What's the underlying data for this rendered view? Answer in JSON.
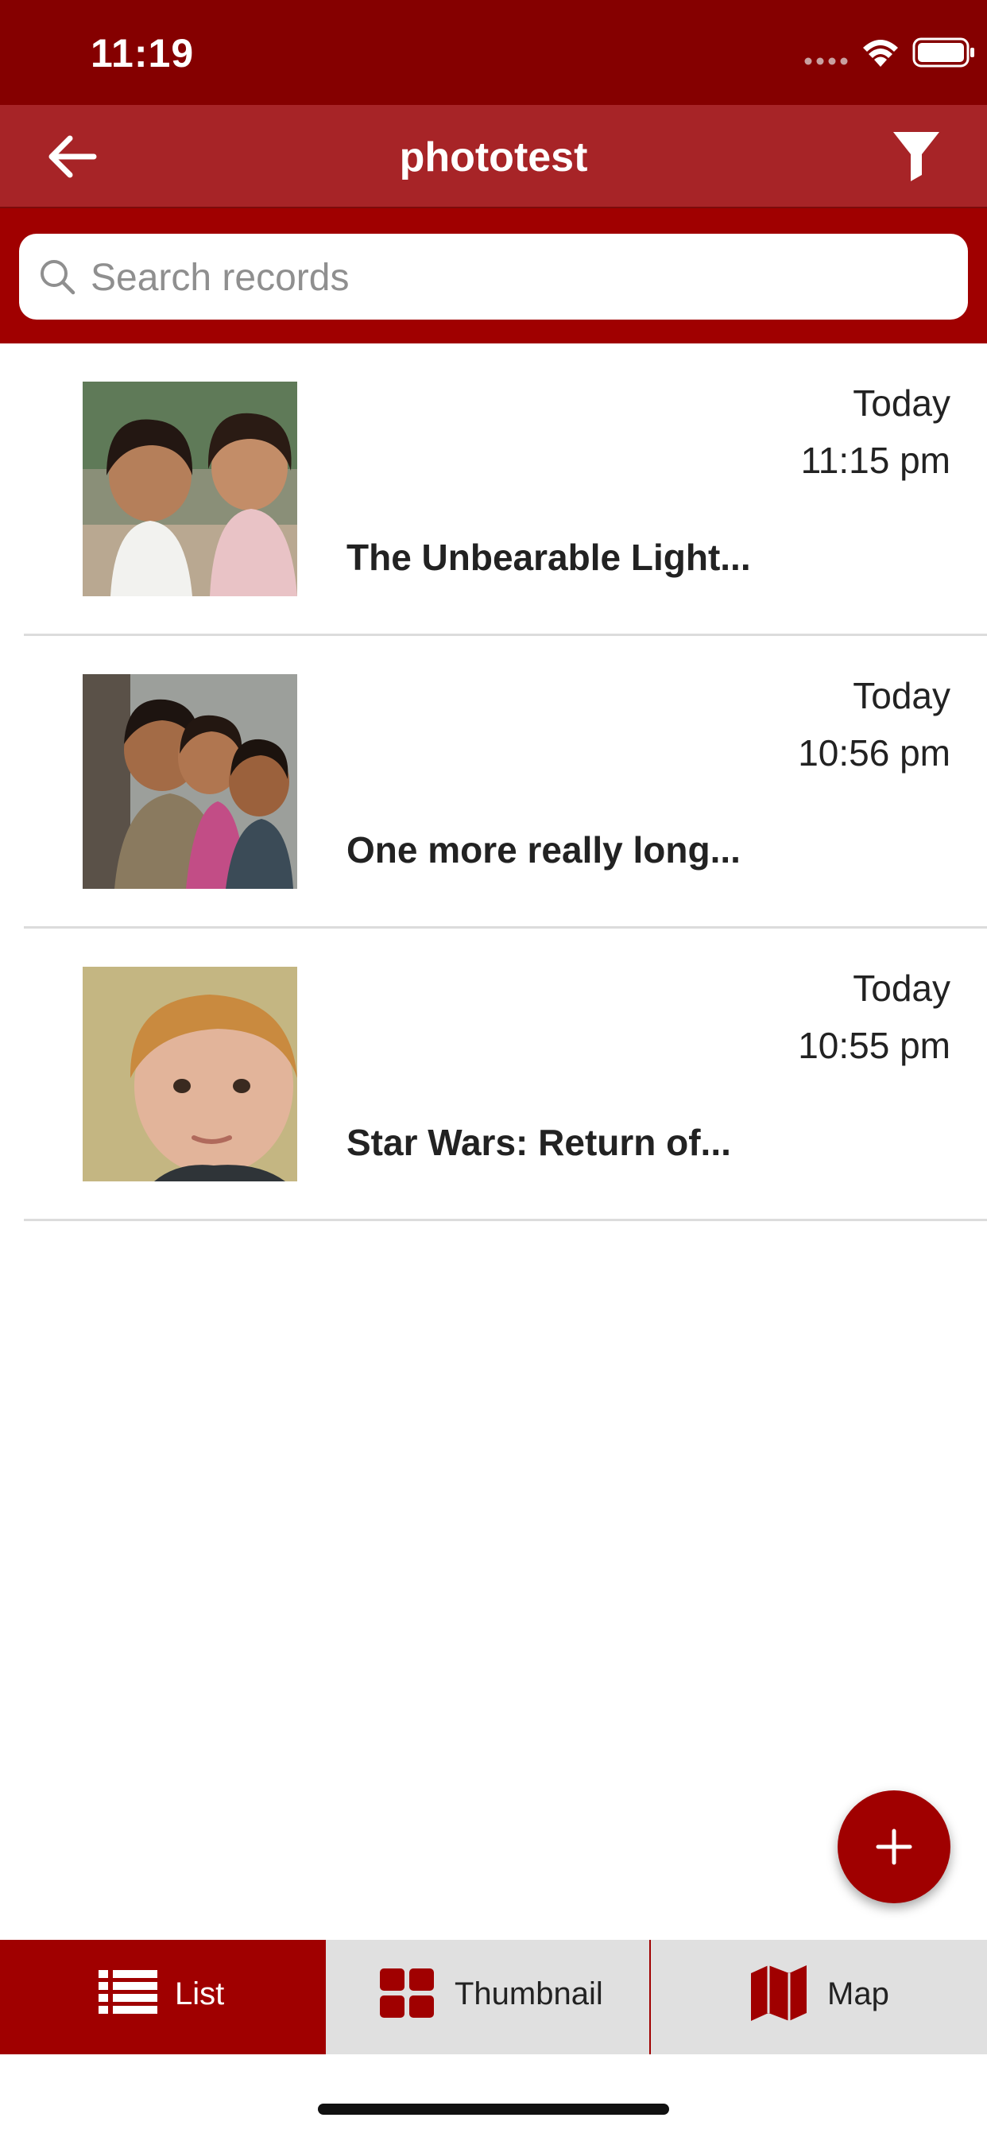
{
  "status_bar": {
    "time": "11:19"
  },
  "nav": {
    "title": "phototest"
  },
  "search": {
    "placeholder": "Search records"
  },
  "records": [
    {
      "day": "Today",
      "time": "11:15 pm",
      "title": "The Unbearable Light..."
    },
    {
      "day": "Today",
      "time": "10:56 pm",
      "title": "One more really long..."
    },
    {
      "day": "Today",
      "time": "10:55 pm",
      "title": "Star Wars: Return of..."
    }
  ],
  "tabs": [
    {
      "label": "List",
      "icon": "list-icon",
      "selected": true
    },
    {
      "label": "Thumbnail",
      "icon": "grid-icon",
      "selected": false
    },
    {
      "label": "Map",
      "icon": "map-icon",
      "selected": false
    }
  ],
  "colors": {
    "status_bar": "#850000",
    "nav_bar": "#a72427",
    "accent": "#a00000",
    "tab_inactive": "#e0e0e0"
  }
}
